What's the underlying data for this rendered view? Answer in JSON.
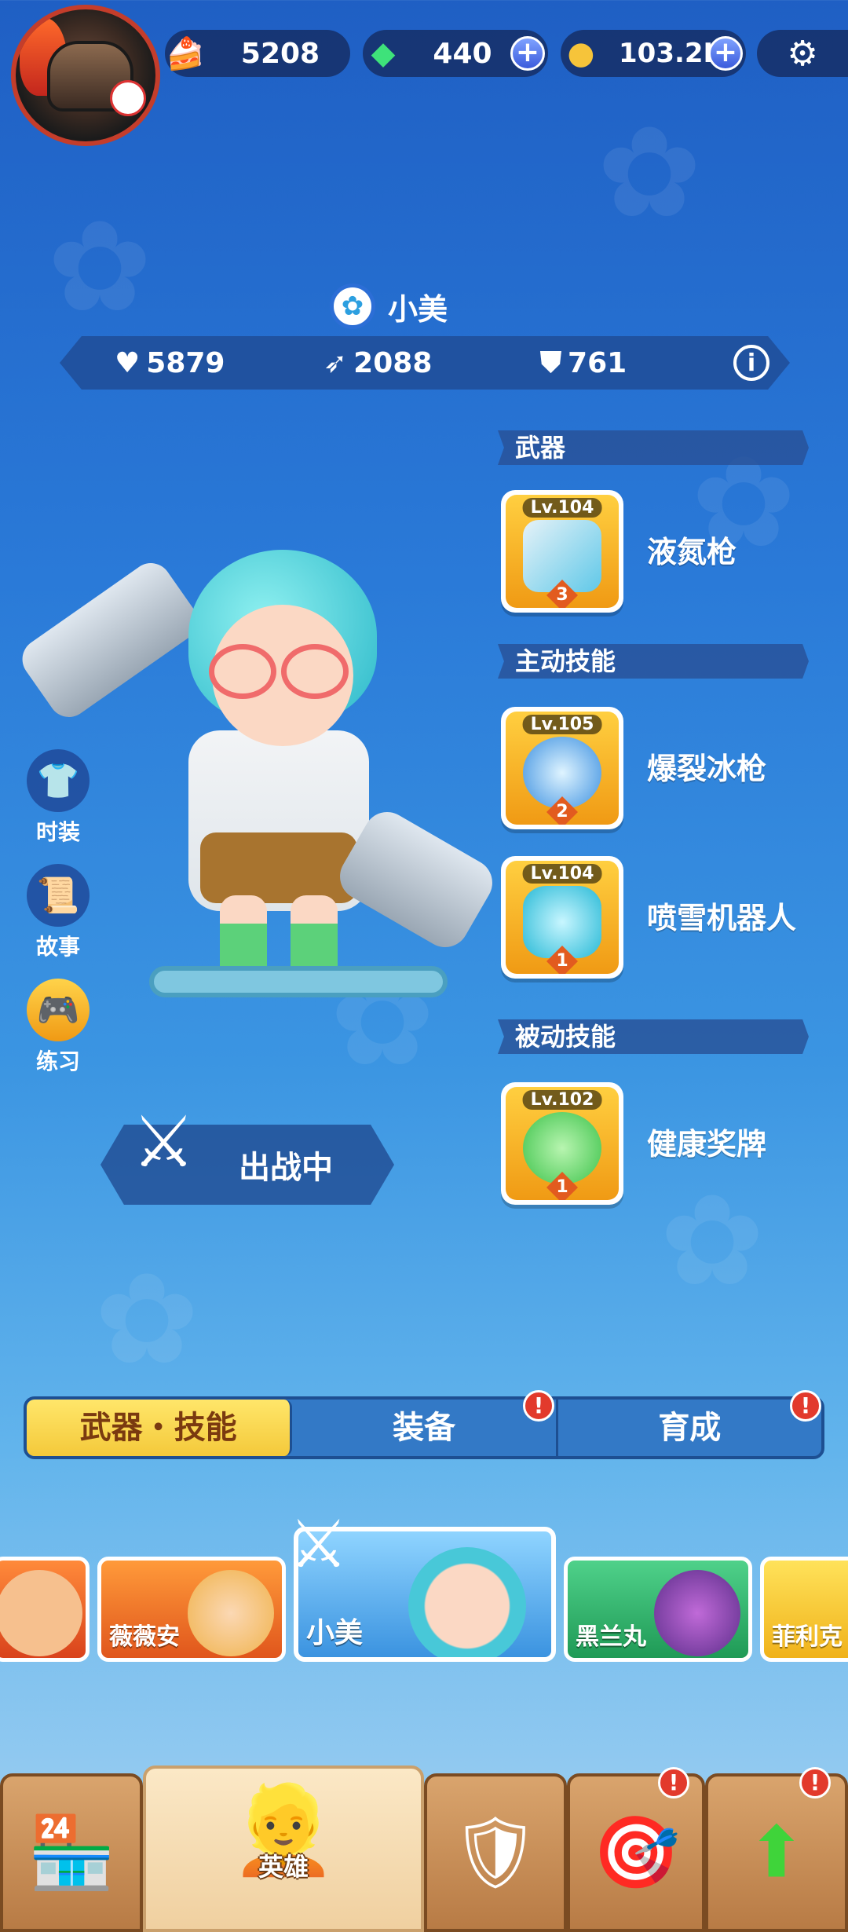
{
  "top": {
    "cake": "5208",
    "gems": "440",
    "coins": "103.2K"
  },
  "hero": {
    "name": "小美",
    "stats": {
      "hp": "5879",
      "attack": "2088",
      "defense": "761"
    }
  },
  "sections": {
    "weapon": "武器",
    "active": "主动技能",
    "passive": "被动技能"
  },
  "skills": [
    {
      "level": "Lv.104",
      "rank": "3",
      "name": "液氮枪"
    },
    {
      "level": "Lv.105",
      "rank": "2",
      "name": "爆裂冰枪"
    },
    {
      "level": "Lv.104",
      "rank": "1",
      "name": "喷雪机器人"
    },
    {
      "level": "Lv.102",
      "rank": "1",
      "name": "健康奖牌"
    }
  ],
  "side_menu": {
    "outfit": "时装",
    "story": "故事",
    "practice": "练习"
  },
  "in_battle": "出战中",
  "tabs": [
    "武器・技能",
    "装备",
    "育成"
  ],
  "heroes": [
    "薇薇安",
    "小美",
    "黑兰丸",
    "菲利克"
  ],
  "nav": {
    "heroes": "英雄"
  },
  "icons": {
    "plus": "+",
    "alert": "!"
  }
}
